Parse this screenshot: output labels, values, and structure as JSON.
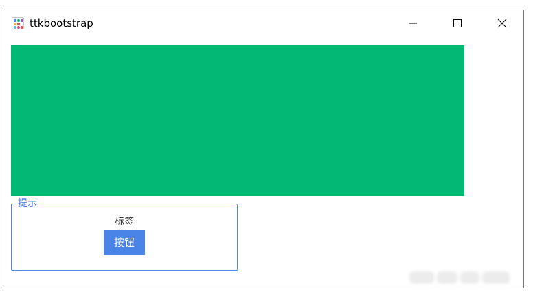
{
  "window": {
    "title": "ttkbootstrap",
    "app_icon": "ttkbootstrap-logo-icon",
    "controls": {
      "minimize_icon": "minimize-icon",
      "maximize_icon": "maximize-icon",
      "close_icon": "close-icon"
    }
  },
  "canvas": {
    "fill_color": "#02b875"
  },
  "labelframe": {
    "title": "提示",
    "label_text": "标签",
    "button_label": "按钮",
    "accent_color": "#4a84e6"
  }
}
